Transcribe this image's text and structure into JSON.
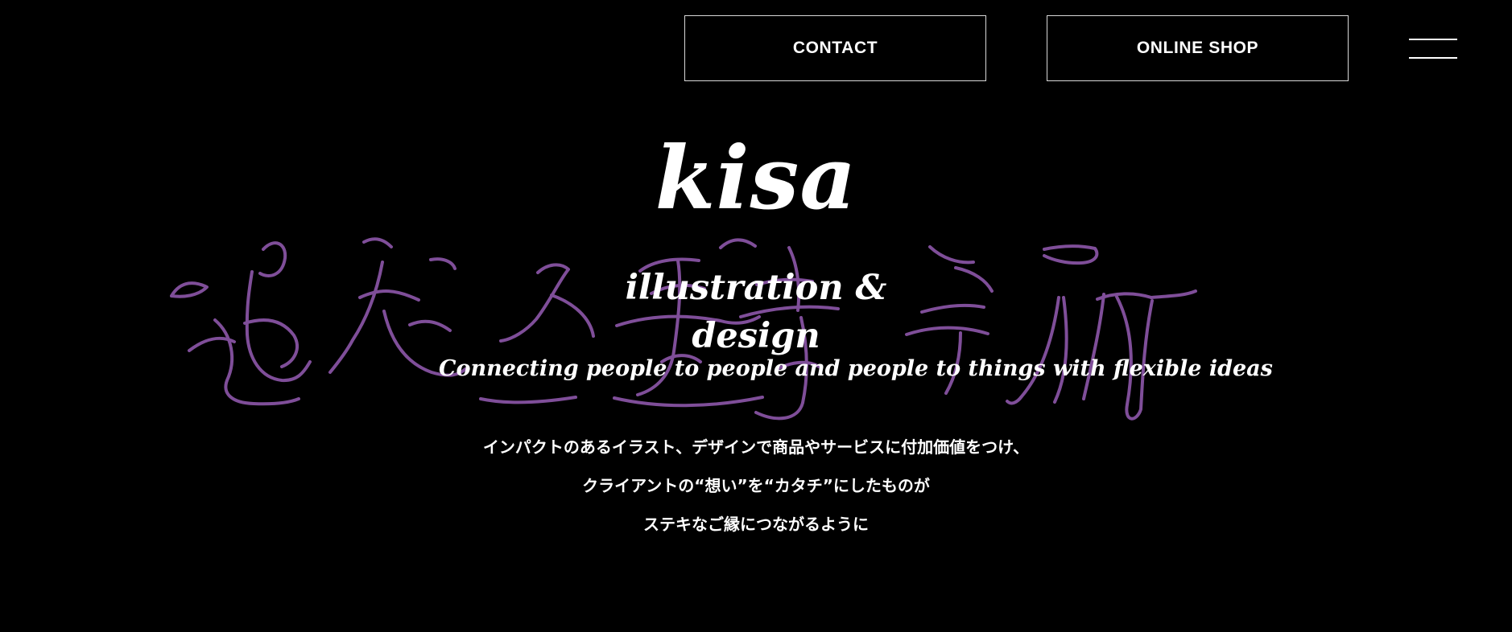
{
  "header": {
    "contact_label": "CONTACT",
    "online_shop_label": "ONLINE SHOP"
  },
  "hero": {
    "brand_name": "kisa",
    "subtitle": "illustration & design",
    "tagline": "Connecting people to people and people to things with flexible ideas",
    "copy_lines": [
      "インパクトのあるイラスト、デザインで商品やサービスに付加価値をつけ、",
      "クライアントの“想い”を“カタチ”にしたものが",
      "ステキなご縁につながるように"
    ]
  },
  "colors": {
    "background": "#000000",
    "text": "#ffffff",
    "button_border": "#d8d8d8",
    "lettering": "#8a55a6"
  },
  "icons": {
    "menu": "hamburger-menu-icon",
    "background_lettering": "hand-drawn-lettering-graphic"
  }
}
